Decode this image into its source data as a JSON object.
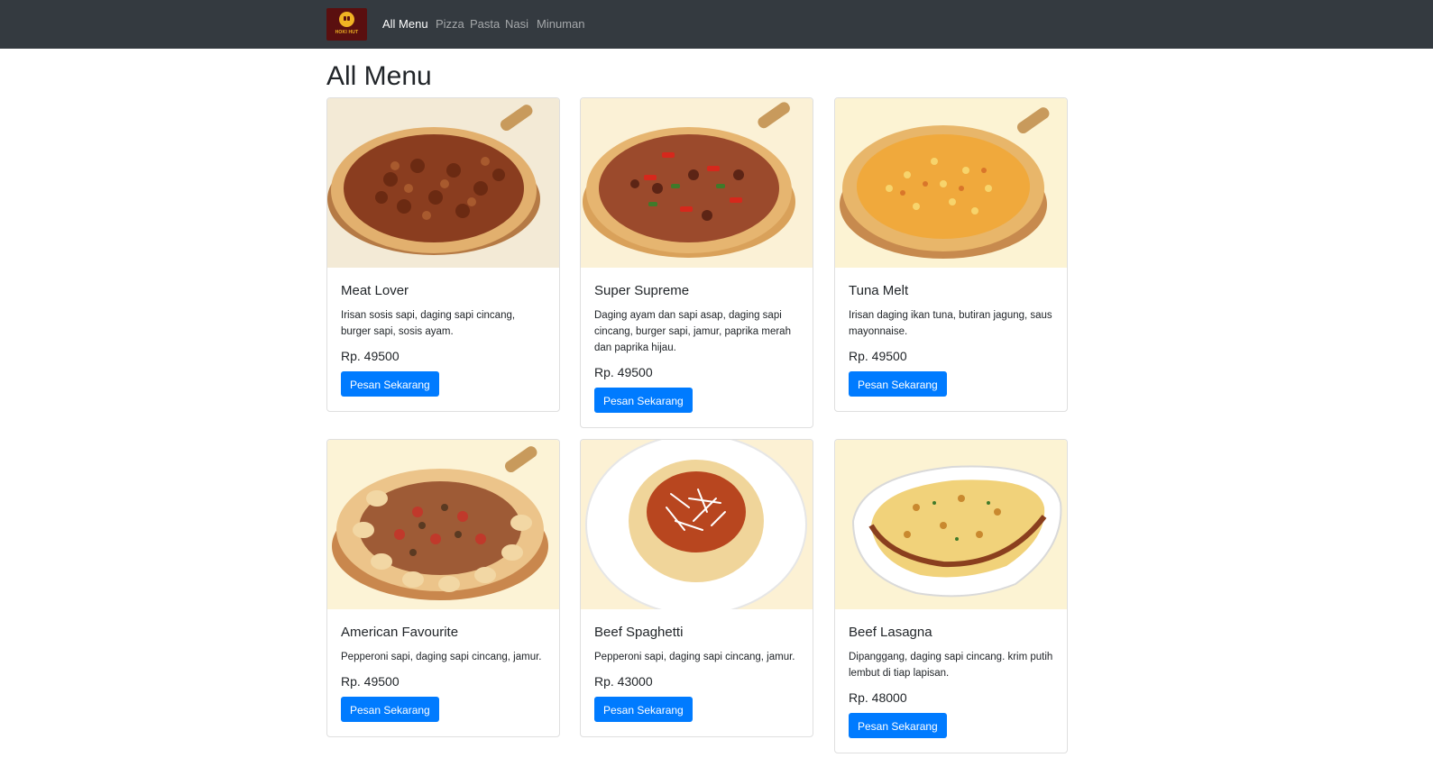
{
  "brand": {
    "logo_text": "HOKI HUT"
  },
  "nav": {
    "items": [
      {
        "label": "All Menu",
        "active": true
      },
      {
        "label": "Pizza",
        "active": false
      },
      {
        "label": "Pasta",
        "active": false
      },
      {
        "label": "Nasi",
        "active": false
      },
      {
        "label": "Minuman",
        "active": false
      }
    ]
  },
  "page": {
    "title": "All Menu"
  },
  "menu": [
    {
      "name": "Meat Lover",
      "description": "Irisan sosis sapi, daging sapi cincang, burger sapi, sosis ayam.",
      "price": "Rp. 49500",
      "button": "Pesan Sekarang",
      "image_icon": "pizza-meat-lover-image"
    },
    {
      "name": "Super Supreme",
      "description": "Daging ayam dan sapi asap, daging sapi cincang, burger sapi, jamur, paprika merah dan paprika hijau.",
      "price": "Rp. 49500",
      "button": "Pesan Sekarang",
      "image_icon": "pizza-super-supreme-image"
    },
    {
      "name": "Tuna Melt",
      "description": "Irisan daging ikan tuna, butiran jagung, saus mayonnaise.",
      "price": "Rp. 49500",
      "button": "Pesan Sekarang",
      "image_icon": "pizza-tuna-melt-image"
    },
    {
      "name": "American Favourite",
      "description": "Pepperoni sapi, daging sapi cincang, jamur.",
      "price": "Rp. 49500",
      "button": "Pesan Sekarang",
      "image_icon": "pizza-american-favourite-image"
    },
    {
      "name": "Beef Spaghetti",
      "description": "Pepperoni sapi, daging sapi cincang, jamur.",
      "price": "Rp. 43000",
      "button": "Pesan Sekarang",
      "image_icon": "spaghetti-image"
    },
    {
      "name": "Beef Lasagna",
      "description": "Dipanggang, daging sapi cincang. krim putih lembut di tiap lapisan.",
      "price": "Rp. 48000",
      "button": "Pesan Sekarang",
      "image_icon": "lasagna-image"
    }
  ],
  "colors": {
    "navbar": "#343a40",
    "primary_button": "#007bff",
    "image_background": "#fdf6dc"
  }
}
